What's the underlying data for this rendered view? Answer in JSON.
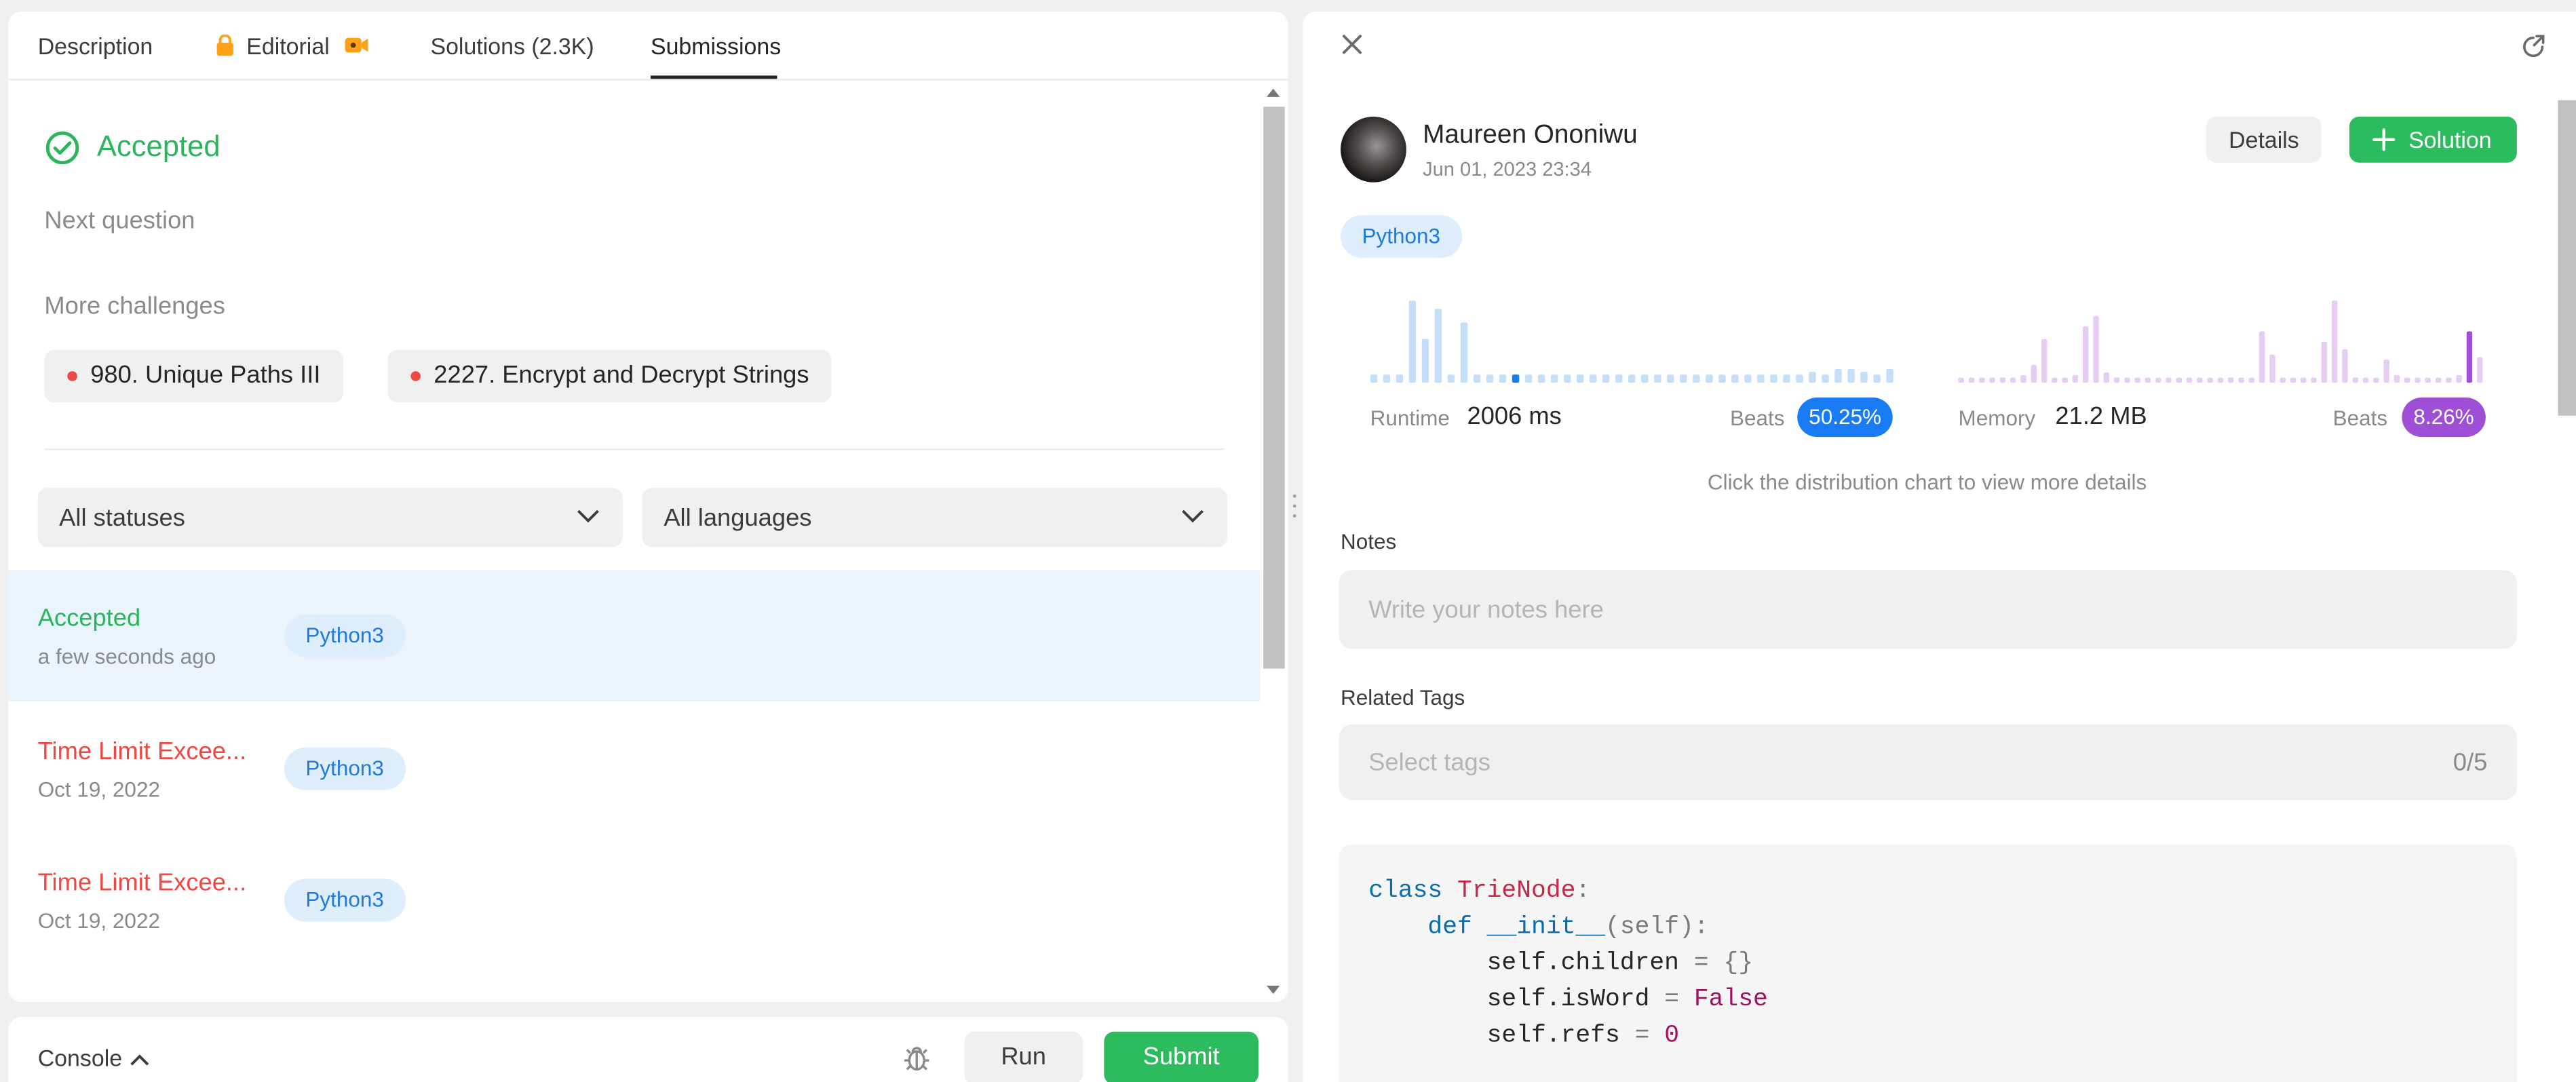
{
  "left_panel": {
    "tabs": [
      {
        "label": "Description"
      },
      {
        "label": "Editorial"
      },
      {
        "label": "Solutions (2.3K)"
      },
      {
        "label": "Submissions"
      }
    ],
    "active_tab": "Submissions",
    "result": {
      "status": "Accepted",
      "next_question": "Next question",
      "more_challenges": "More challenges"
    },
    "challenges": [
      {
        "label": "980. Unique Paths III"
      },
      {
        "label": "2227. Encrypt and Decrypt Strings"
      }
    ],
    "filters": {
      "status": "All statuses",
      "language": "All languages"
    },
    "submissions": [
      {
        "status": "Accepted",
        "time": "a few seconds ago",
        "lang": "Python3",
        "color": "#2db55d"
      },
      {
        "status": "Time Limit Excee...",
        "time": "Oct 19, 2022",
        "lang": "Python3",
        "color": "#ef4743"
      },
      {
        "status": "Time Limit Excee...",
        "time": "Oct 19, 2022",
        "lang": "Python3",
        "color": "#ef4743"
      }
    ]
  },
  "console": {
    "label": "Console",
    "run": "Run",
    "submit": "Submit"
  },
  "right_panel": {
    "user": {
      "name": "Maureen Ononiwu",
      "date": "Jun 01, 2023 23:34"
    },
    "details_label": "Details",
    "solution_label": "Solution",
    "language": "Python3",
    "runtime": {
      "label": "Runtime",
      "value": "2006 ms",
      "beats_label": "Beats",
      "beats": "50.25%",
      "color": "#1a7cf5"
    },
    "memory": {
      "label": "Memory",
      "value": "21.2 MB",
      "beats_label": "Beats",
      "beats": "8.26%",
      "color": "#9f4ed6"
    },
    "hint": "Click the distribution chart to view more details",
    "notes": {
      "label": "Notes",
      "placeholder": "Write your notes here"
    },
    "tags": {
      "label": "Related Tags",
      "placeholder": "Select tags",
      "count": "0/5"
    },
    "code": {
      "line1_kw": "class",
      "line1_name": "TrieNode",
      "line1_end": ":",
      "line2_kw": "def",
      "line2_fn": "__init__",
      "line2_args": "(self):",
      "line3_a": "self",
      "line3_b": ".children ",
      "line3_op": "=",
      "line3_c": " {}",
      "line4_a": "self",
      "line4_b": ".isWord ",
      "line4_op": "=",
      "line4_c": " False",
      "line5_a": "self",
      "line5_b": ".refs ",
      "line5_op": "=",
      "line5_c": " 0"
    }
  },
  "chart_data": [
    {
      "type": "bar",
      "title": "Runtime distribution",
      "x": [],
      "values": [
        3,
        3,
        3,
        30,
        16,
        27,
        3,
        22,
        3,
        3,
        3,
        3,
        3,
        3,
        3,
        3,
        3,
        3,
        3,
        3,
        3,
        3,
        3,
        3,
        3,
        3,
        3,
        3,
        3,
        3,
        3,
        3,
        3,
        3,
        4,
        3,
        5,
        5,
        4,
        3,
        5
      ],
      "highlight_index": 11,
      "highlight_color": "#1a7cf5",
      "bar_color": "#c5dff9"
    },
    {
      "type": "bar",
      "title": "Memory distribution",
      "values": [
        2,
        2,
        2,
        2,
        2,
        2,
        3,
        7,
        17,
        2,
        2,
        3,
        22,
        26,
        4,
        2,
        2,
        2,
        2,
        2,
        2,
        2,
        2,
        2,
        2,
        2,
        2,
        2,
        2,
        20,
        11,
        2,
        2,
        2,
        2,
        16,
        32,
        13,
        2,
        2,
        2,
        9,
        3,
        2,
        2,
        2,
        2,
        2,
        3,
        20,
        10
      ],
      "highlight_index": 49,
      "highlight_color": "#9f4ed6",
      "bar_color": "#e7cdf3"
    }
  ]
}
